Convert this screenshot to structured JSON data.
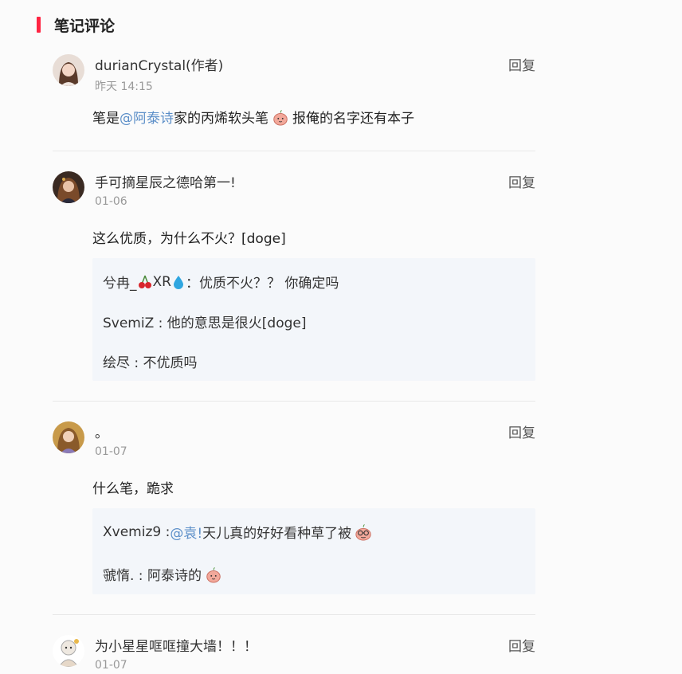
{
  "section": {
    "title": "笔记评论"
  },
  "reply_label": "回复",
  "comments": [
    {
      "author": "durianCrystal(作者)",
      "date": "昨天 14:15",
      "content_pre": "笔是 ",
      "content_mention": "@阿泰诗",
      "content_post": " 家的丙烯软头笔",
      "content_tail": "报俺的名字还有本子"
    },
    {
      "author": "手可摘星辰之德哈第一!",
      "date": "01-06",
      "content": "这么优质，为什么不火？[doge]",
      "replies": [
        {
          "name_a": "兮冉_",
          "name_b": "XR",
          "text": "：优质不火？？ 你确定吗"
        },
        {
          "line": "SvemiZ : 他的意思是很火[doge]"
        },
        {
          "line": "绘尽 : 不优质吗"
        }
      ]
    },
    {
      "author": "。",
      "date": "01-07",
      "content": "什么笔，跪求",
      "replies": [
        {
          "prefix": "Xvemiz9 : ",
          "mention": "@袁!",
          "text": "  天儿真的好好看种草了被"
        },
        {
          "line": "虢惰. : 阿泰诗的"
        }
      ]
    },
    {
      "author": "为小星星哐哐撞大墙！！！",
      "date": "01-07"
    }
  ]
}
